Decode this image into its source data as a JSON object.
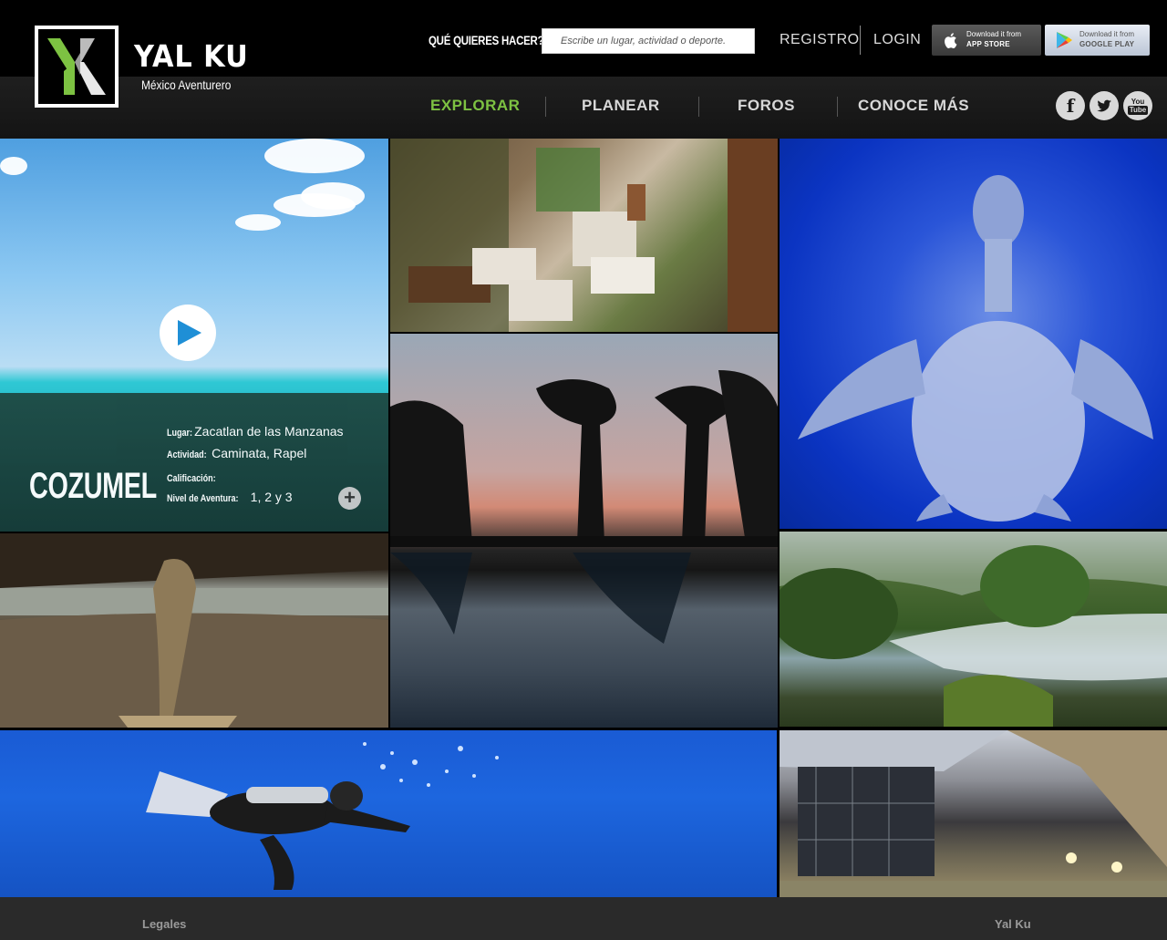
{
  "brand": {
    "name": "YAL KU",
    "tagline": "México Aventurero",
    "logo_mark": "YK",
    "accent_color": "#7dc242"
  },
  "header": {
    "search_label": "QUÉ QUIERES HACER?",
    "search_placeholder": "Escribe un lugar, actividad o deporte.",
    "register": "REGISTRO",
    "login": "LOGIN",
    "app_store": {
      "line1": "Download it from",
      "line2": "APP STORE",
      "icon": "apple-icon"
    },
    "google_play": {
      "line1": "Download it from",
      "line2": "GOOGLE PLAY",
      "icon": "google-play-icon"
    }
  },
  "nav": {
    "items": [
      {
        "label": "EXPLORAR",
        "active": true
      },
      {
        "label": "PLANEAR",
        "active": false
      },
      {
        "label": "FOROS",
        "active": false
      },
      {
        "label": "CONOCE MÁS",
        "active": false
      }
    ],
    "social": [
      {
        "name": "facebook-icon",
        "glyph": "f"
      },
      {
        "name": "twitter-icon",
        "glyph": "t"
      },
      {
        "name": "youtube-icon",
        "glyph": "You Tube"
      }
    ]
  },
  "featured": {
    "title": "COZUMEL",
    "place_label": "Lugar:",
    "place_value": "Zacatlan de las Manzanas",
    "activity_label": "Actividad:",
    "activity_value": "Caminata, Rapel",
    "rating_label": "Calificación:",
    "level_label": "Nivel de Aventura:",
    "level_value": "1, 2 y 3",
    "more": "+"
  },
  "footer": {
    "left": "Legales",
    "right": "Yal Ku"
  }
}
